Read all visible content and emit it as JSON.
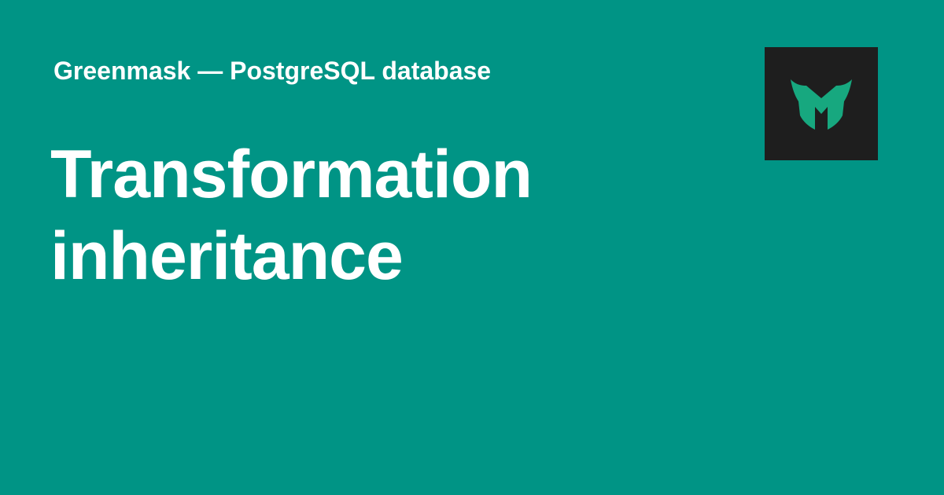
{
  "header": {
    "site_title": "Greenmask — PostgreSQL database"
  },
  "page": {
    "title": "Transformation inheritance"
  },
  "logo": {
    "icon": "greenmask-logo-icon",
    "colors": {
      "background": "#1e1e1e",
      "mark": "#17a87f"
    }
  },
  "theme": {
    "background": "#009485",
    "text": "#ffffff"
  }
}
